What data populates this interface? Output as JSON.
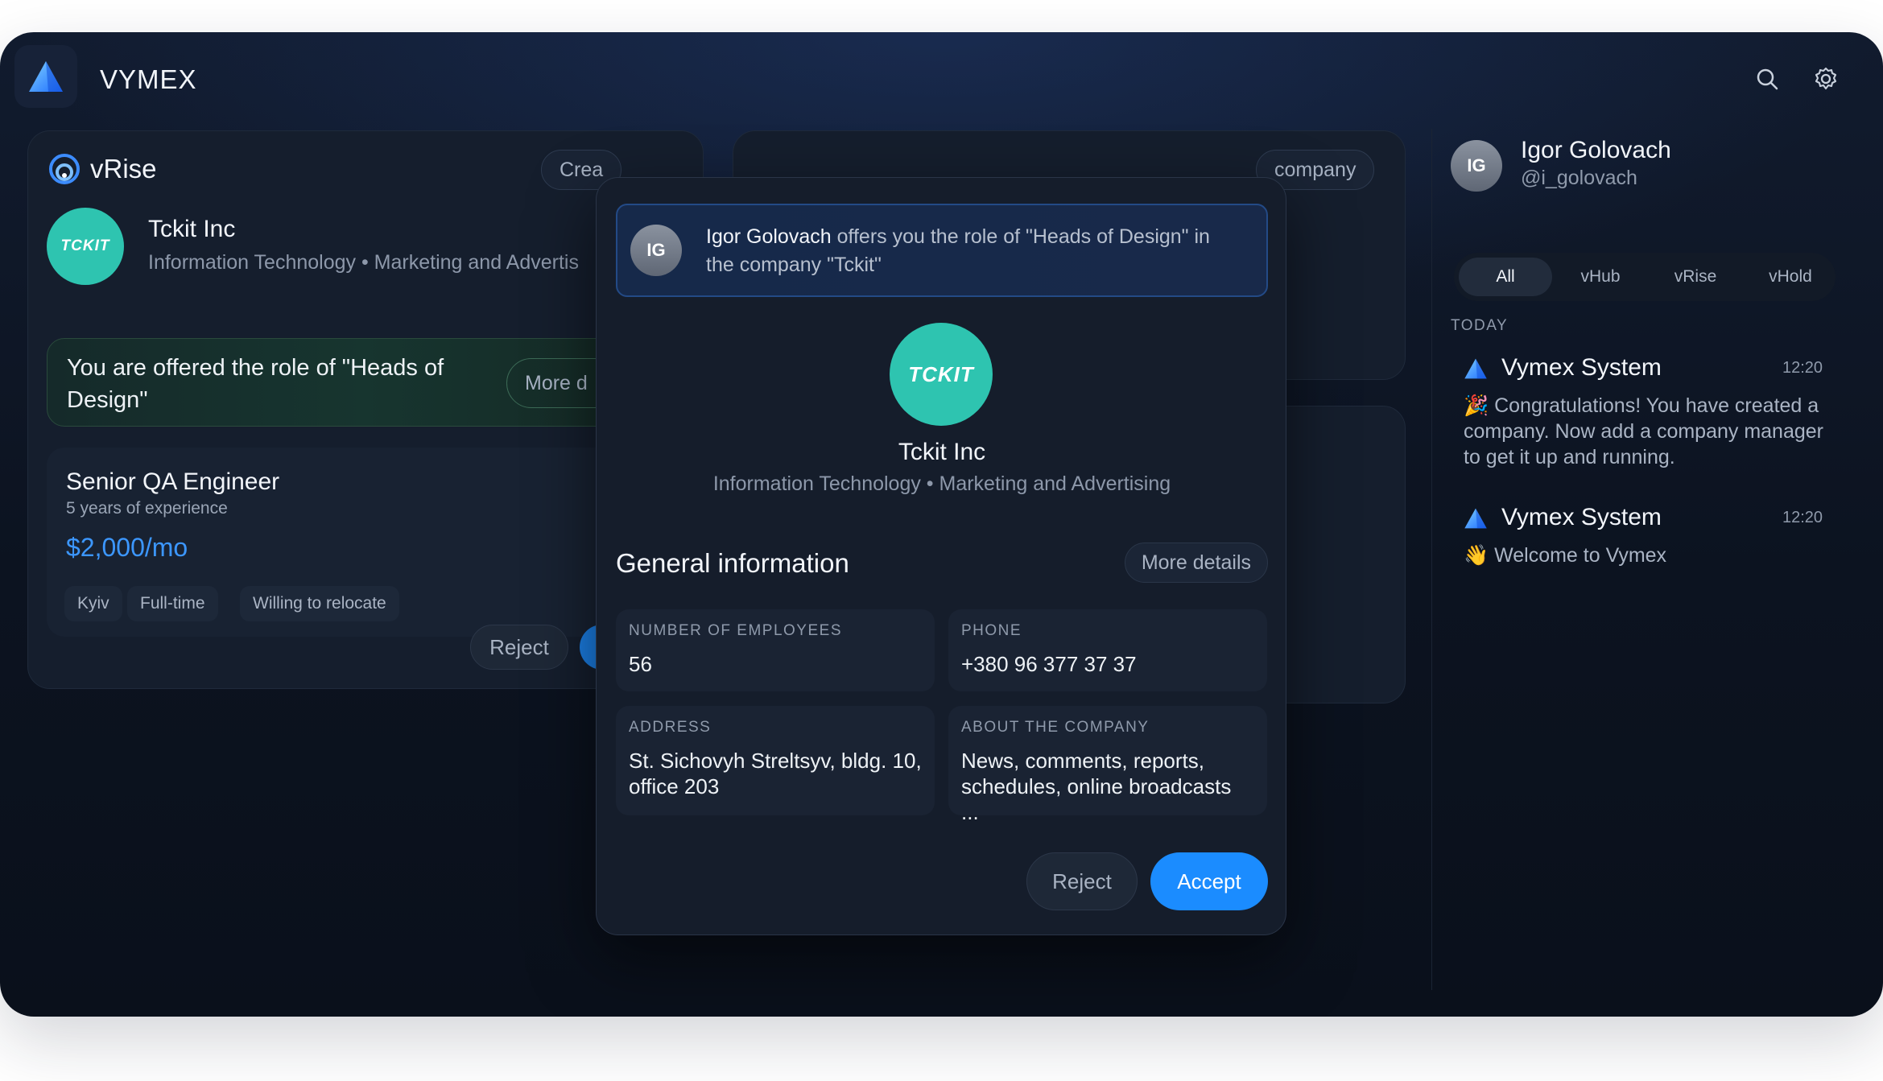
{
  "app": {
    "title": "VYMEX"
  },
  "header": {
    "icons": [
      "search-icon",
      "gear-icon"
    ]
  },
  "left_card": {
    "brand": "vRise",
    "create_button": "Crea",
    "company": {
      "name": "Tckit Inc",
      "logo_text": "TCKIT",
      "industry": "Information Technology • Marketing and Advertis"
    },
    "offer": {
      "text": "You are offered the role of \"Heads of Design\"",
      "more_button": "More d"
    },
    "job": {
      "title": "Senior QA Engineer",
      "experience": "5 years of experience",
      "salary": "$2,000/mo",
      "tags": [
        "Kyiv",
        "Full-time",
        "Willing to relocate"
      ]
    },
    "reject_button": "Reject"
  },
  "middle_card": {
    "button": "company"
  },
  "modal": {
    "notice": {
      "initials": "IG",
      "sender": "Igor Golovach",
      "message": " offers you the role of \"Heads of Design\" in the company \"Tckit\""
    },
    "company": {
      "logo_text": "TCKIT",
      "name": "Tckit Inc",
      "industry": "Information Technology • Marketing and Advertising"
    },
    "section_title": "General information",
    "more_details": "More details",
    "info": [
      {
        "label": "NUMBER OF EMPLOYEES",
        "value": "56"
      },
      {
        "label": "PHONE",
        "value": "+380 96 377 37 37"
      },
      {
        "label": "ADDRESS",
        "value": "St. Sichovyh Streltsyv, bldg. 10, office 203"
      },
      {
        "label": "ABOUT THE COMPANY",
        "value": "News, comments, reports, schedules, online broadcasts ..."
      }
    ],
    "reject": "Reject",
    "accept": "Accept"
  },
  "right_panel": {
    "user": {
      "initials": "IG",
      "name": "Igor Golovach",
      "handle": "@i_golovach"
    },
    "tabs": [
      "All",
      "vHub",
      "vRise",
      "vHold"
    ],
    "active_tab": "All",
    "section": "TODAY",
    "notifications": [
      {
        "title": "Vymex System",
        "time": "12:20",
        "emoji": "🎉",
        "body": "Congratulations! You have created a company. Now add a company manager to get it up and running."
      },
      {
        "title": "Vymex System",
        "time": "12:20",
        "emoji": "👋",
        "body": "Welcome to Vymex"
      }
    ]
  },
  "colors": {
    "accent": "#1b8cff",
    "brand_teal": "#2ec4b0",
    "salary": "#3c97ff"
  }
}
